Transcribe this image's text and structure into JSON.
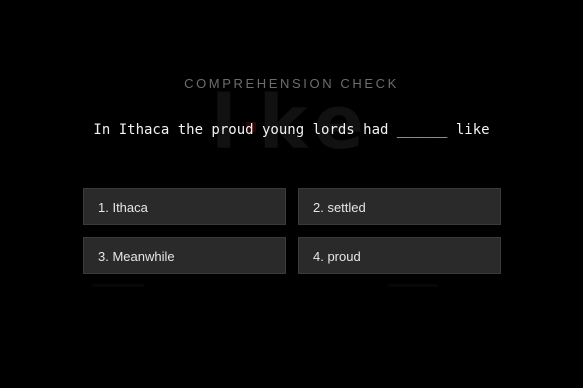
{
  "background_word": {
    "left": "l",
    "right": "ke",
    "accent_color": "#2a0606"
  },
  "quiz": {
    "heading": "COMPREHENSION CHECK",
    "question": "In Ithaca the proud young lords had ______ like",
    "options": [
      {
        "label": "1. Ithaca"
      },
      {
        "label": "2. settled"
      },
      {
        "label": "3. Meanwhile"
      },
      {
        "label": "4. proud"
      }
    ]
  },
  "colors": {
    "background": "#000000",
    "option_fill": "#2a2a2a",
    "option_border": "#3a3a3a",
    "heading_text": "#6d6d6d",
    "question_text": "#f2f2f2"
  }
}
